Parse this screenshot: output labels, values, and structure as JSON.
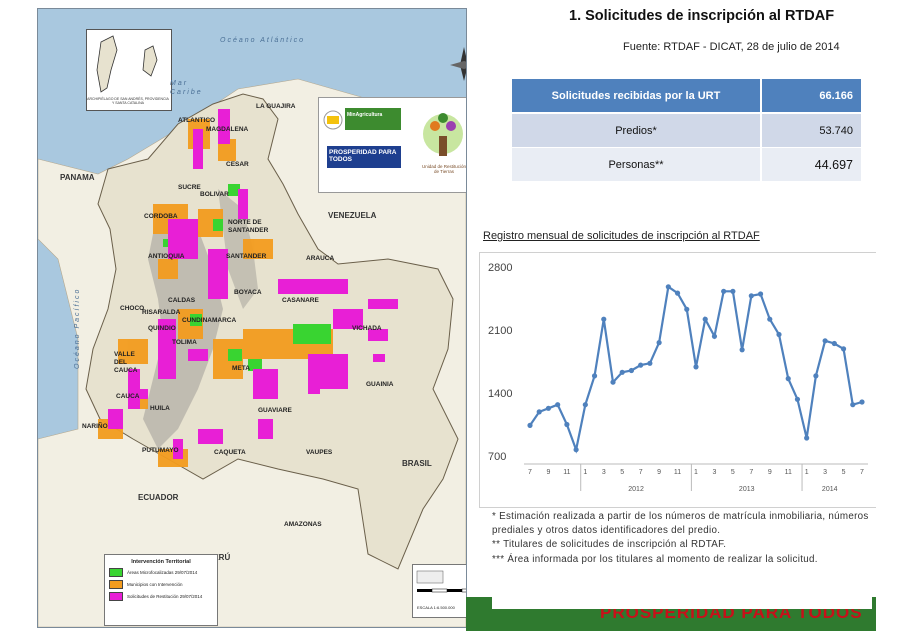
{
  "map": {
    "ocean_atlantic": "Océano Atlántico",
    "ocean_pacific": "Océano Pacífico",
    "mar_caribe": "Mar Caribe",
    "inset_caption": "ARCHIPIÉLAGO DE SAN ANDRÉS, PROVIDENCIA Y SANTA CATALINA",
    "countries": [
      {
        "id": "panama",
        "label": "PANAMA"
      },
      {
        "id": "venezuela",
        "label": "VENEZUELA"
      },
      {
        "id": "ecuador",
        "label": "ECUADOR"
      },
      {
        "id": "peru",
        "label": "PERÚ"
      },
      {
        "id": "brasil",
        "label": "BRASIL"
      }
    ],
    "departments": [
      {
        "id": "la-guajira",
        "label": "LA GUAJIRA"
      },
      {
        "id": "atlantico",
        "label": "ATLANTICO"
      },
      {
        "id": "magdalena",
        "label": "MAGDALENA"
      },
      {
        "id": "cesar",
        "label": "CESAR"
      },
      {
        "id": "sucre",
        "label": "SUCRE"
      },
      {
        "id": "bolivar",
        "label": "BOLIVAR"
      },
      {
        "id": "cordoba",
        "label": "CORDOBA"
      },
      {
        "id": "norte-santander",
        "label": "NORTE DE SANTANDER"
      },
      {
        "id": "antioquia",
        "label": "ANTIOQUIA"
      },
      {
        "id": "santander",
        "label": "SANTANDER"
      },
      {
        "id": "arauca",
        "label": "ARAUCA"
      },
      {
        "id": "choco",
        "label": "CHOCO"
      },
      {
        "id": "boyaca",
        "label": "BOYACA"
      },
      {
        "id": "caldas",
        "label": "CALDAS"
      },
      {
        "id": "casanare",
        "label": "CASANARE"
      },
      {
        "id": "risaralda",
        "label": "RISARALDA"
      },
      {
        "id": "cundinamarca",
        "label": "CUNDINAMARCA"
      },
      {
        "id": "quindio",
        "label": "QUINDIO"
      },
      {
        "id": "tolima",
        "label": "TOLIMA"
      },
      {
        "id": "vichada",
        "label": "VICHADA"
      },
      {
        "id": "valle",
        "label": "VALLE DEL CAUCA"
      },
      {
        "id": "meta",
        "label": "META"
      },
      {
        "id": "cauca",
        "label": "CAUCA"
      },
      {
        "id": "guainia",
        "label": "GUAINIA"
      },
      {
        "id": "huila",
        "label": "HUILA"
      },
      {
        "id": "guaviare",
        "label": "GUAVIARE"
      },
      {
        "id": "narino",
        "label": "NARIÑO"
      },
      {
        "id": "caqueta",
        "label": "CAQUETA"
      },
      {
        "id": "putumayo",
        "label": "PUTUMAYO"
      },
      {
        "id": "vaupes",
        "label": "VAUPES"
      },
      {
        "id": "amazonas",
        "label": "AMAZONAS"
      }
    ],
    "logos": {
      "minagricultura": "MinAgricultura",
      "prosperidad": "PROSPERIDAD PARA TODOS",
      "unidad": "Unidad de Restitución de Tierras"
    },
    "legend": {
      "title": "Intervención Territorial",
      "items": [
        {
          "label": "Áreas Microfocalizadas 29/07/2014",
          "color": "#39d431"
        },
        {
          "label": "Municipios con Intervención",
          "color": "#f39c1f"
        },
        {
          "label": "Solicitudes de Restitución 29/07/2014",
          "color": "#e81fd6"
        }
      ]
    },
    "scale": {
      "text": "ESCALA 1:6.500.000",
      "north": "N"
    },
    "colors": {
      "ocean": "#a9c8df",
      "land": "#e7e2cf",
      "neighbor": "#f2efe3",
      "mountain": "#a7a49d"
    }
  },
  "panel": {
    "title": "1. Solicitudes de inscripción al RTDAF",
    "source": "Fuente: RTDAF - DICAT, 28 de julio de 2014",
    "table": {
      "header": {
        "label": "Solicitudes recibidas por la URT",
        "value": "66.166"
      },
      "rows": [
        {
          "label": "Predios*",
          "value": "53.740"
        },
        {
          "label": "Personas**",
          "value": "44.697"
        }
      ]
    },
    "chart_title": "Registro mensual de solicitudes de inscripción al RTDAF",
    "notes": [
      "* Estimación realizada a partir de los números de matrícula inmobiliaria, números prediales y otros datos identificadores del predio.",
      "** Titulares de solicitudes de inscripción al RDTAF.",
      "*** Área informada por los titulares al momento de realizar la solicitud."
    ],
    "footer": "PROSPERIDAD PARA TODOS",
    "accent": "#4f81bd",
    "footer_color": "#2f7a2f"
  },
  "chart_data": {
    "type": "line",
    "title": "",
    "xlabel": "",
    "ylabel": "",
    "ylim": [
      700,
      2800
    ],
    "yticks": [
      700,
      1400,
      2100,
      2800
    ],
    "grid": false,
    "x": [
      "7",
      "9",
      "11",
      "1",
      "3",
      "5",
      "7",
      "9",
      "11",
      "1",
      "3",
      "5",
      "7",
      "9",
      "11",
      "1",
      "3",
      "5",
      "7"
    ],
    "x_full": [
      "2011-07",
      "2011-08",
      "2011-09",
      "2011-10",
      "2011-11",
      "2011-12",
      "2012-01",
      "2012-02",
      "2012-03",
      "2012-04",
      "2012-05",
      "2012-06",
      "2012-07",
      "2012-08",
      "2012-09",
      "2012-10",
      "2012-11",
      "2012-12",
      "2013-01",
      "2013-02",
      "2013-03",
      "2013-04",
      "2013-05",
      "2013-06",
      "2013-07",
      "2013-08",
      "2013-09",
      "2013-10",
      "2013-11",
      "2013-12",
      "2014-01",
      "2014-02",
      "2014-03",
      "2014-04",
      "2014-05",
      "2014-06",
      "2014-07"
    ],
    "year_labels": [
      "2012",
      "2013",
      "2014"
    ],
    "series": [
      {
        "name": "",
        "color": "#4f81bd",
        "values": [
          1040,
          1190,
          1230,
          1270,
          1050,
          770,
          1270,
          1590,
          2220,
          1520,
          1630,
          1650,
          1710,
          1730,
          1960,
          2580,
          2510,
          2330,
          1690,
          2220,
          2030,
          2530,
          2530,
          1880,
          2480,
          2500,
          2220,
          2050,
          1560,
          1330,
          900,
          1590,
          1980,
          1950,
          1890,
          1270,
          1300
        ]
      }
    ]
  }
}
